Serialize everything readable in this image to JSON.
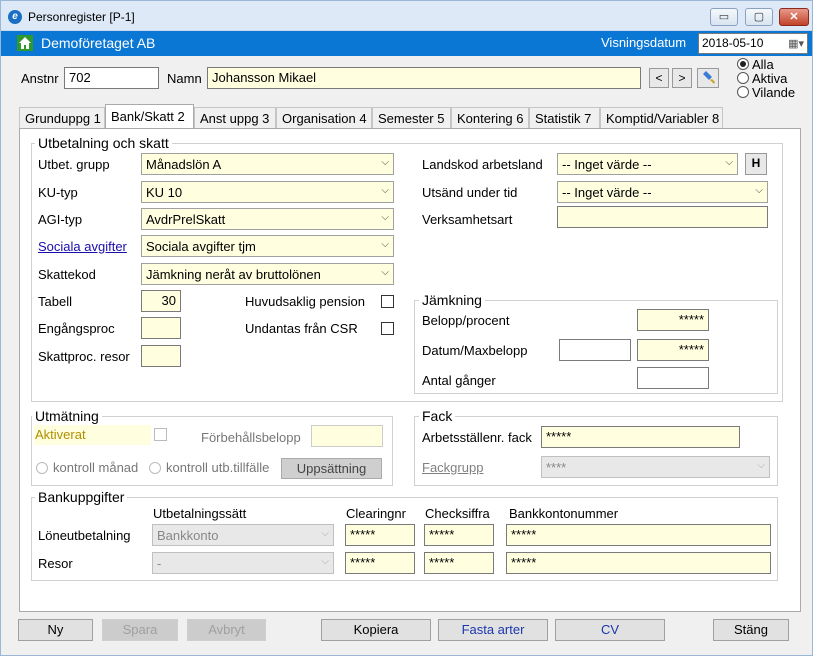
{
  "window": {
    "title": "Personregister [P-1]",
    "min": "▭",
    "max": "▢",
    "close": "✕"
  },
  "header": {
    "company": "Demoföretaget AB",
    "viewdate_label": "Visningsdatum",
    "viewdate": "2018-05-10"
  },
  "person": {
    "anstnr_label": "Anstnr",
    "anstnr": "702",
    "namn_label": "Namn",
    "namn": "Johansson Mikael",
    "prev": "<",
    "next": ">"
  },
  "filter": {
    "alla": "Alla",
    "aktiva": "Aktiva",
    "vilande": "Vilande"
  },
  "tabs": [
    "Grunduppg 1",
    "Bank/Skatt 2",
    "Anst uppg 3",
    "Organisation 4",
    "Semester 5",
    "Kontering 6",
    "Statistik 7",
    "Komptid/Variabler 8"
  ],
  "utbetalning": {
    "title": "Utbetalning och skatt",
    "utbet_grupp_label": "Utbet. grupp",
    "utbet_grupp": "Månadslön A",
    "ku_typ_label": "KU-typ",
    "ku_typ": "KU 10",
    "agi_typ_label": "AGI-typ",
    "agi_typ": "AvdrPrelSkatt",
    "sociala_label": "Sociala avgifter",
    "sociala": "Sociala avgifter tjm",
    "skattekod_label": "Skattekod",
    "skattekod": "Jämkning neråt av bruttolönen",
    "tabell_label": "Tabell",
    "tabell": "30",
    "engangsproc_label": "Engångsproc",
    "skattproc_label": "Skattproc. resor",
    "huvudsaklig_label": "Huvudsaklig pension",
    "undantas_label": "Undantas från CSR",
    "landskod_label": "Landskod arbetsland",
    "landskod": "-- Inget värde --",
    "h_btn": "H",
    "utsand_label": "Utsänd under tid",
    "utsand": "-- Inget värde --",
    "verksamhet_label": "Verksamhetsart"
  },
  "jamkning": {
    "title": "Jämkning",
    "belopp_label": "Belopp/procent",
    "belopp": "*****",
    "datum_label": "Datum/Maxbelopp",
    "maxbelopp": "*****",
    "antal_label": "Antal gånger"
  },
  "utmatning": {
    "title": "Utmätning",
    "aktiverat_label": "Aktiverat",
    "forbehall_label": "Förbehållsbelopp",
    "kontroll_manad": "kontroll månad",
    "kontroll_utb": "kontroll utb.tillfälle",
    "uppsattning": "Uppsättning"
  },
  "fack": {
    "title": "Fack",
    "arbetsst_label": "Arbetsställenr. fack",
    "arbetsst": "*****",
    "fackgrupp_label": "Fackgrupp",
    "fackgrupp": "****"
  },
  "bank": {
    "title": "Bankuppgifter",
    "col_utbetalningssatt": "Utbetalningssätt",
    "col_clearing": "Clearingnr",
    "col_check": "Checksiffra",
    "col_konto": "Bankkontonummer",
    "rows": [
      {
        "label": "Löneutbetalning",
        "satt": "Bankkonto",
        "clearing": "*****",
        "check": "*****",
        "konto": "*****"
      },
      {
        "label": "Resor",
        "satt": "-",
        "clearing": "*****",
        "check": "*****",
        "konto": "*****"
      }
    ]
  },
  "buttons": {
    "ny": "Ny",
    "spara": "Spara",
    "avbryt": "Avbryt",
    "kopiera": "Kopiera",
    "fasta": "Fasta arter",
    "cv": "CV",
    "stang": "Stäng"
  },
  "colors": {
    "titlebar": "#dde9f6",
    "bluebar": "#0b77d4",
    "field_yellow": "#ffffe0",
    "link": "#1a0dab"
  }
}
